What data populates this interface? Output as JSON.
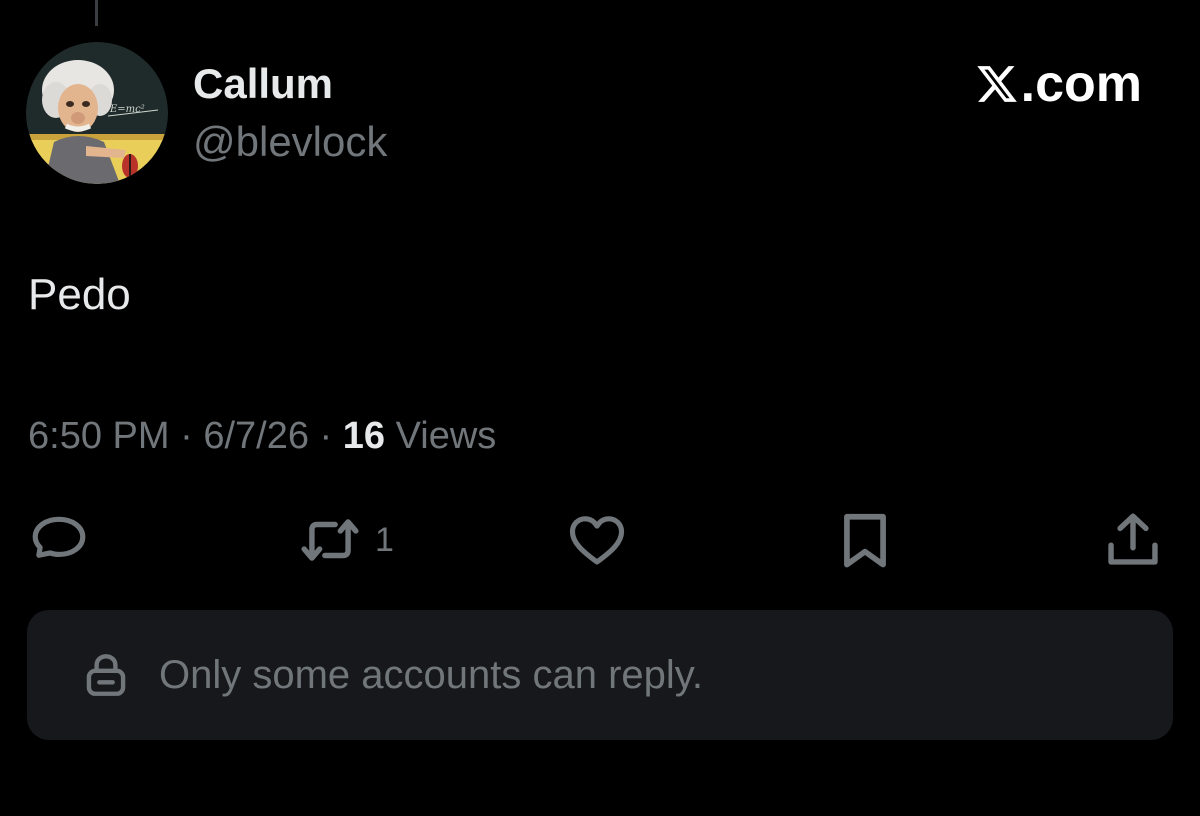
{
  "author": {
    "name": "Callum",
    "handle": "@blevlock"
  },
  "brand": {
    "text": ".com",
    "logo_icon": "x-logo-icon"
  },
  "post": {
    "text": "Pedo"
  },
  "meta": {
    "time": "6:50 PM",
    "separator": "·",
    "date": "6/7/26",
    "views_count": "16",
    "views_label": "Views"
  },
  "actions": {
    "reply_icon": "reply-icon",
    "repost_icon": "repost-icon",
    "repost_count": "1",
    "like_icon": "heart-icon",
    "bookmark_icon": "bookmark-icon",
    "share_icon": "share-icon"
  },
  "reply_restriction": {
    "icon": "lock-icon",
    "text": "Only some accounts can reply."
  },
  "colors": {
    "background": "#000000",
    "primary_text": "#e7e9ea",
    "secondary_text": "#71767b",
    "notice_background": "#16181c"
  }
}
